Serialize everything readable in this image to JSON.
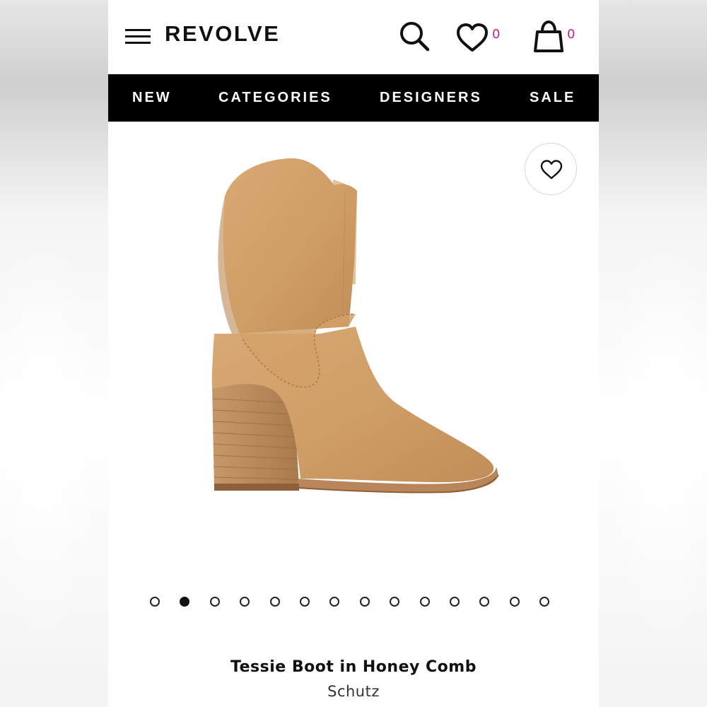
{
  "header": {
    "logo": "REVOLVE",
    "wishlist_count": "0",
    "bag_count": "0"
  },
  "nav": {
    "items": [
      {
        "label": "NEW"
      },
      {
        "label": "CATEGORIES"
      },
      {
        "label": "DESIGNERS"
      },
      {
        "label": "SALE"
      }
    ]
  },
  "gallery": {
    "image_count": 14,
    "active_index": 1
  },
  "product": {
    "title": "Tessie Boot in Honey Comb",
    "brand": "Schutz"
  },
  "colors": {
    "accent_count": "#c0249b",
    "boot_suede": "#cf9f6a",
    "heel_wood": "#b7885a"
  },
  "icons": [
    "menu-icon",
    "search-icon",
    "heart-icon",
    "bag-icon"
  ]
}
